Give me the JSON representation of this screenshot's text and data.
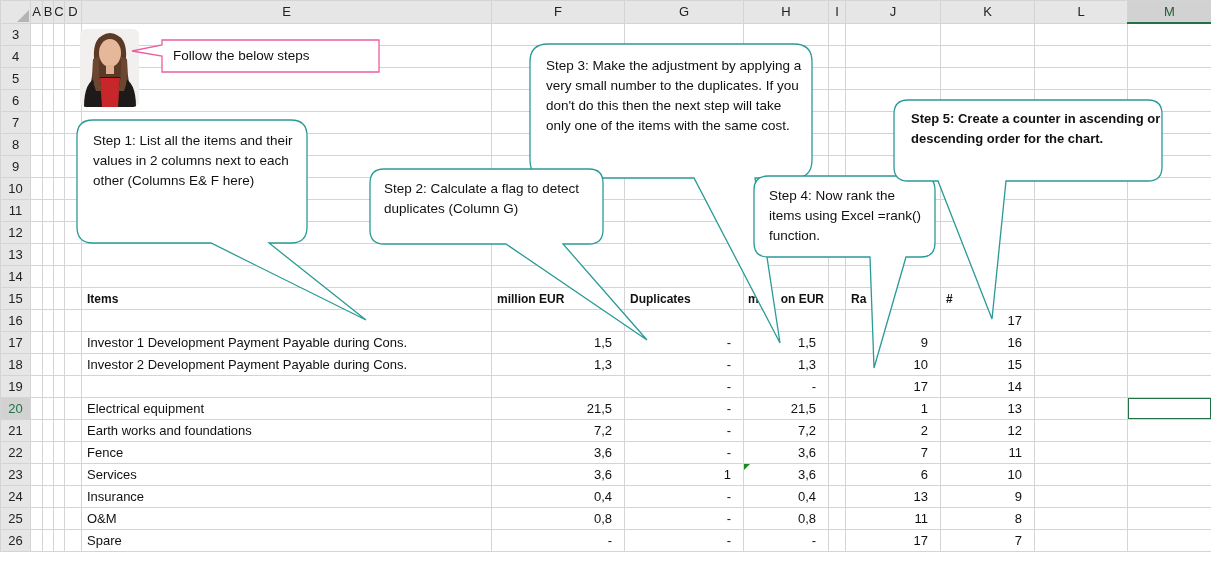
{
  "columns": [
    {
      "label": "A",
      "selected": false
    },
    {
      "label": "B",
      "selected": false
    },
    {
      "label": "C",
      "selected": false
    },
    {
      "label": "D",
      "selected": false
    },
    {
      "label": "E",
      "selected": false
    },
    {
      "label": "F",
      "selected": false
    },
    {
      "label": "G",
      "selected": false
    },
    {
      "label": "H",
      "selected": false
    },
    {
      "label": "I",
      "selected": false
    },
    {
      "label": "J",
      "selected": false
    },
    {
      "label": "K",
      "selected": false
    },
    {
      "label": "L",
      "selected": false
    },
    {
      "label": "M",
      "selected": true
    }
  ],
  "rows": [
    {
      "number": "3",
      "selected": false,
      "kind": "data",
      "cells": {}
    },
    {
      "number": "4",
      "selected": false,
      "kind": "data",
      "cells": {}
    },
    {
      "number": "5",
      "selected": false,
      "kind": "data",
      "cells": {}
    },
    {
      "number": "6",
      "selected": false,
      "kind": "data",
      "cells": {}
    },
    {
      "number": "7",
      "selected": false,
      "kind": "data",
      "cells": {}
    },
    {
      "number": "8",
      "selected": false,
      "kind": "data",
      "cells": {}
    },
    {
      "number": "9",
      "selected": false,
      "kind": "data",
      "cells": {}
    },
    {
      "number": "10",
      "selected": false,
      "kind": "data",
      "cells": {}
    },
    {
      "number": "11",
      "selected": false,
      "kind": "data",
      "cells": {}
    },
    {
      "number": "12",
      "selected": false,
      "kind": "data",
      "cells": {}
    },
    {
      "number": "13",
      "selected": false,
      "kind": "data",
      "cells": {}
    },
    {
      "number": "14",
      "selected": false,
      "kind": "data",
      "cells": {}
    },
    {
      "number": "15",
      "selected": false,
      "kind": "header",
      "cells": {
        "e": "Items",
        "f": "million EUR",
        "g": "Duplicates",
        "h": [
          "m",
          "on EUR"
        ],
        "j": "Ra",
        "k": "#"
      }
    },
    {
      "number": "16",
      "selected": false,
      "kind": "data",
      "cells": {
        "k": "17"
      }
    },
    {
      "number": "17",
      "selected": false,
      "kind": "data",
      "cells": {
        "e": "Investor 1 Development Payment Payable during Cons.",
        "f": "1,5",
        "g": "-",
        "h": "1,5",
        "j": "9",
        "k": "16"
      }
    },
    {
      "number": "18",
      "selected": false,
      "kind": "data",
      "cells": {
        "e": "Investor 2 Development Payment Payable during Cons.",
        "f": "1,3",
        "g": "-",
        "h": "1,3",
        "j": "10",
        "k": "15"
      }
    },
    {
      "number": "19",
      "selected": false,
      "kind": "data",
      "cells": {
        "g": "-",
        "h": "-",
        "j": "17",
        "k": "14"
      }
    },
    {
      "number": "20",
      "selected": true,
      "kind": "data",
      "cells": {
        "e": "Electrical equipment",
        "f": "21,5",
        "g": "-",
        "h": "21,5",
        "j": "1",
        "k": "13"
      }
    },
    {
      "number": "21",
      "selected": false,
      "kind": "data",
      "cells": {
        "e": "Earth works and foundations",
        "f": "7,2",
        "g": "-",
        "h": "7,2",
        "j": "2",
        "k": "12"
      }
    },
    {
      "number": "22",
      "selected": false,
      "kind": "data",
      "cells": {
        "e": "Fence",
        "f": "3,6",
        "g": "-",
        "h": "3,6",
        "j": "7",
        "k": "11"
      }
    },
    {
      "number": "23",
      "selected": false,
      "kind": "data",
      "note": true,
      "cells": {
        "e": "Services",
        "f": "3,6",
        "g": "1",
        "h": "3,6",
        "j": "6",
        "k": "10"
      }
    },
    {
      "number": "24",
      "selected": false,
      "kind": "data",
      "cells": {
        "e": "Insurance",
        "f": "0,4",
        "g": "-",
        "h": "0,4",
        "j": "13",
        "k": "9"
      }
    },
    {
      "number": "25",
      "selected": false,
      "kind": "data",
      "cells": {
        "e": "O&M",
        "f": "0,8",
        "g": "-",
        "h": "0,8",
        "j": "11",
        "k": "8"
      }
    },
    {
      "number": "26",
      "selected": false,
      "kind": "data",
      "cells": {
        "e": "Spare",
        "f": "-",
        "g": "-",
        "h": "-",
        "j": "17",
        "k": "7"
      }
    }
  ],
  "callouts": [
    {
      "kind": "rectangle",
      "text": "Follow the below steps",
      "bold": false
    },
    {
      "kind": "rounded",
      "text": "Step 1: List all the items and their values in 2 columns next to each other (Columns E& F here)",
      "bold": false
    },
    {
      "kind": "rounded",
      "text": "Step 2: Calculate a flag to detect duplicates (Column G)",
      "bold": false
    },
    {
      "kind": "rounded",
      "text": "Step 3: Make the adjustment by applying a very small number to the duplicates. If you don't do this then the next step will take only one of the items with the same cost.",
      "bold": false
    },
    {
      "kind": "rounded",
      "text": "Step 4: Now rank the items using Excel =rank() function.",
      "bold": false
    },
    {
      "kind": "rounded",
      "text": "Step 5: Create a counter in ascending or descending order for the chart.",
      "bold": true
    }
  ]
}
